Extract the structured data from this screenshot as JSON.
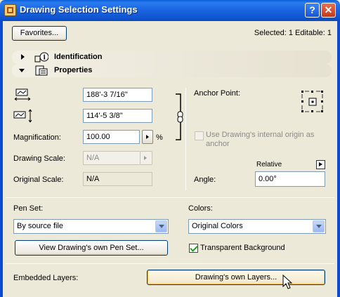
{
  "window": {
    "title": "Drawing Selection Settings"
  },
  "titlebar": {
    "help_label": "?",
    "close_label": "✕"
  },
  "top": {
    "favorites_label": "Favorites...",
    "selection_info": "Selected: 1 Editable: 1"
  },
  "panels": {
    "identification": {
      "label": "Identification",
      "icon": "info-icon"
    },
    "properties": {
      "label": "Properties",
      "icon": "properties-icon"
    }
  },
  "size": {
    "width_value": "188'-3 7/16\"",
    "height_value": "114'-5 3/8\""
  },
  "magnification": {
    "label": "Magnification:",
    "value": "100.00",
    "unit": "%"
  },
  "drawing_scale": {
    "label": "Drawing Scale:",
    "value": "N/A"
  },
  "original_scale": {
    "label": "Original Scale:",
    "value": "N/A"
  },
  "anchor": {
    "label": "Anchor Point:",
    "internal_origin_label": "Use Drawing's internal origin as anchor",
    "internal_origin_checked": false
  },
  "angle": {
    "label": "Angle:",
    "value": "0.00°",
    "relative_label": "Relative"
  },
  "pen_set": {
    "label": "Pen Set:",
    "value": "By source file",
    "view_button_label": "View Drawing's own Pen Set..."
  },
  "colors": {
    "label": "Colors:",
    "value": "Original Colors",
    "transparent_label": "Transparent Background",
    "transparent_checked": true
  },
  "layers": {
    "label": "Embedded Layers:",
    "button_label": "Drawing's own Layers..."
  }
}
